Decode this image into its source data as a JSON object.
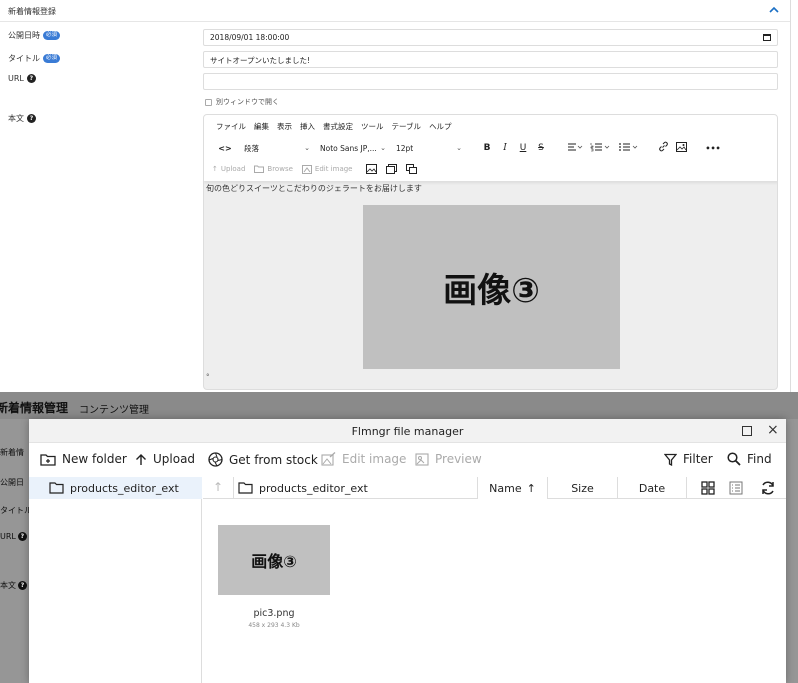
{
  "section": {
    "title": "新着情報登録"
  },
  "form": {
    "publish_label": "公開日時",
    "required_badge": "必須",
    "publish_value": "2018/09/01 18:00:00",
    "title_label": "タイトル",
    "title_value": "サイトオープンいたしました!",
    "url_label": "URL",
    "url_value": "",
    "new_window_label": "別ウィンドウで開く",
    "body_label": "本文",
    "help_glyph": "?"
  },
  "editor": {
    "menu": [
      "ファイル",
      "編集",
      "表示",
      "挿入",
      "書式設定",
      "ツール",
      "テーブル",
      "ヘルプ"
    ],
    "code_glyph": "<>",
    "block_format": "段落",
    "font_family": "Noto Sans JP,...",
    "font_size": "12pt",
    "bold": "B",
    "italic": "I",
    "underline": "U",
    "strike": "S",
    "more": "•••",
    "upload_label": "Upload",
    "browse_label": "Browse",
    "edit_image_label": "Edit image",
    "content_text": "旬の色どりスイーツとこだわりのジェラートをお届けします",
    "content_image_text": "画像③",
    "trailing_mark": "°"
  },
  "background_page": {
    "title": "新着情報管理",
    "subtitle": "コンテンツ管理",
    "side_labels": [
      "新着情",
      "公開日",
      "タイトル",
      "URL",
      "本文"
    ]
  },
  "file_manager": {
    "title": "Flmngr file manager",
    "close_glyph": "×",
    "toolbar": {
      "new_folder": "New folder",
      "upload": "Upload",
      "get_from_stock": "Get from stock",
      "edit_image": "Edit image",
      "preview": "Preview",
      "filter": "Filter",
      "find": "Find"
    },
    "up_glyph": "↑",
    "sidebar_folder": "products_editor_ext",
    "current_path": "products_editor_ext",
    "columns": {
      "name": "Name",
      "size": "Size",
      "date": "Date"
    },
    "sort_arrow": "↑",
    "file": {
      "thumb_text": "画像③",
      "name": "pic3.png",
      "meta": "458 x 293  4.3 Kb"
    }
  }
}
